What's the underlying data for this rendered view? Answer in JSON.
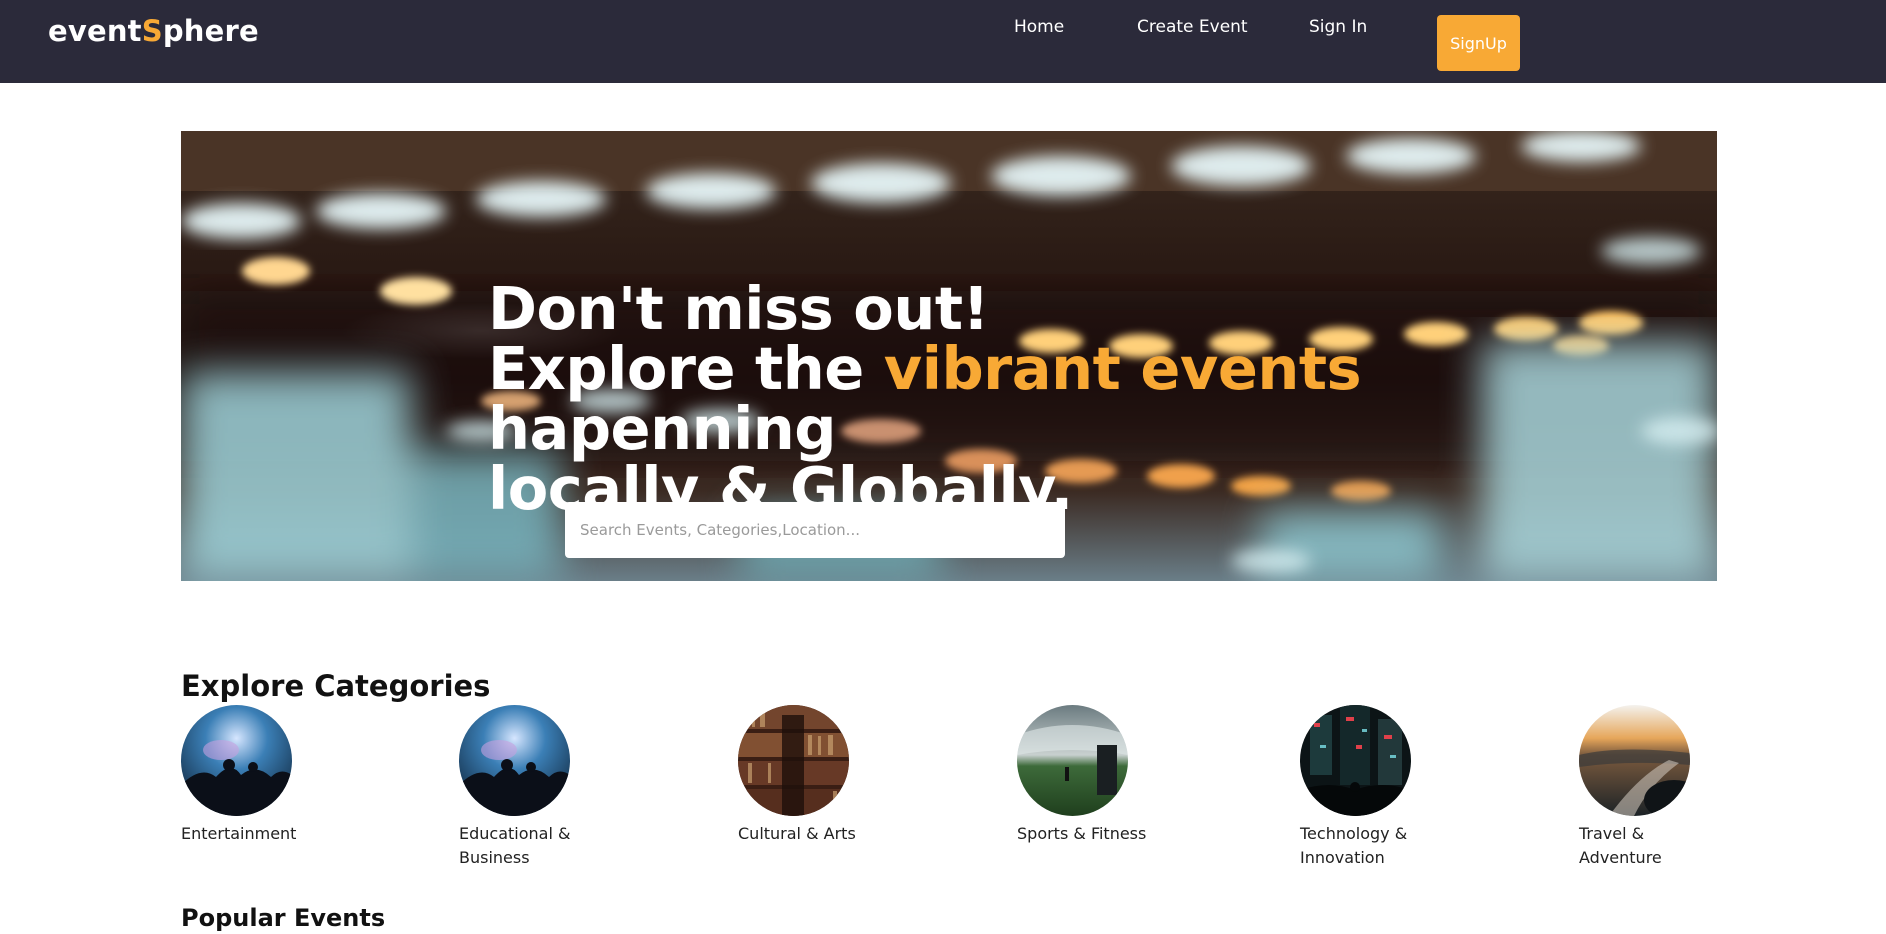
{
  "brand": {
    "prefix": "event",
    "accent_letter": "S",
    "suffix": "phere"
  },
  "nav": {
    "home": "Home",
    "create_event": "Create Event",
    "sign_in": "Sign In",
    "sign_up": "SignUp"
  },
  "hero": {
    "line1": "Don't miss out!",
    "line2_prefix": "Explore the ",
    "line2_highlight": "vibrant events",
    "line2_suffix": " hapenning",
    "line3": "locally & Globally.",
    "search_placeholder": "Search Events, Categories,Location..."
  },
  "categories_title": "Explore Categories",
  "categories": [
    {
      "label": "Entertainment",
      "icon": "concert-image"
    },
    {
      "label": "Educational & Business",
      "icon": "concert-image"
    },
    {
      "label": "Cultural & Arts",
      "icon": "bookshelf-image"
    },
    {
      "label": "Sports & Fitness",
      "icon": "stadium-image"
    },
    {
      "label": "Technology & Innovation",
      "icon": "neon-city-image"
    },
    {
      "label": "Travel & Adventure",
      "icon": "sunset-landscape-image"
    }
  ],
  "popular_title": "Popular Events",
  "colors": {
    "navbar": "#2b2a3a",
    "accent": "#f8a935"
  }
}
